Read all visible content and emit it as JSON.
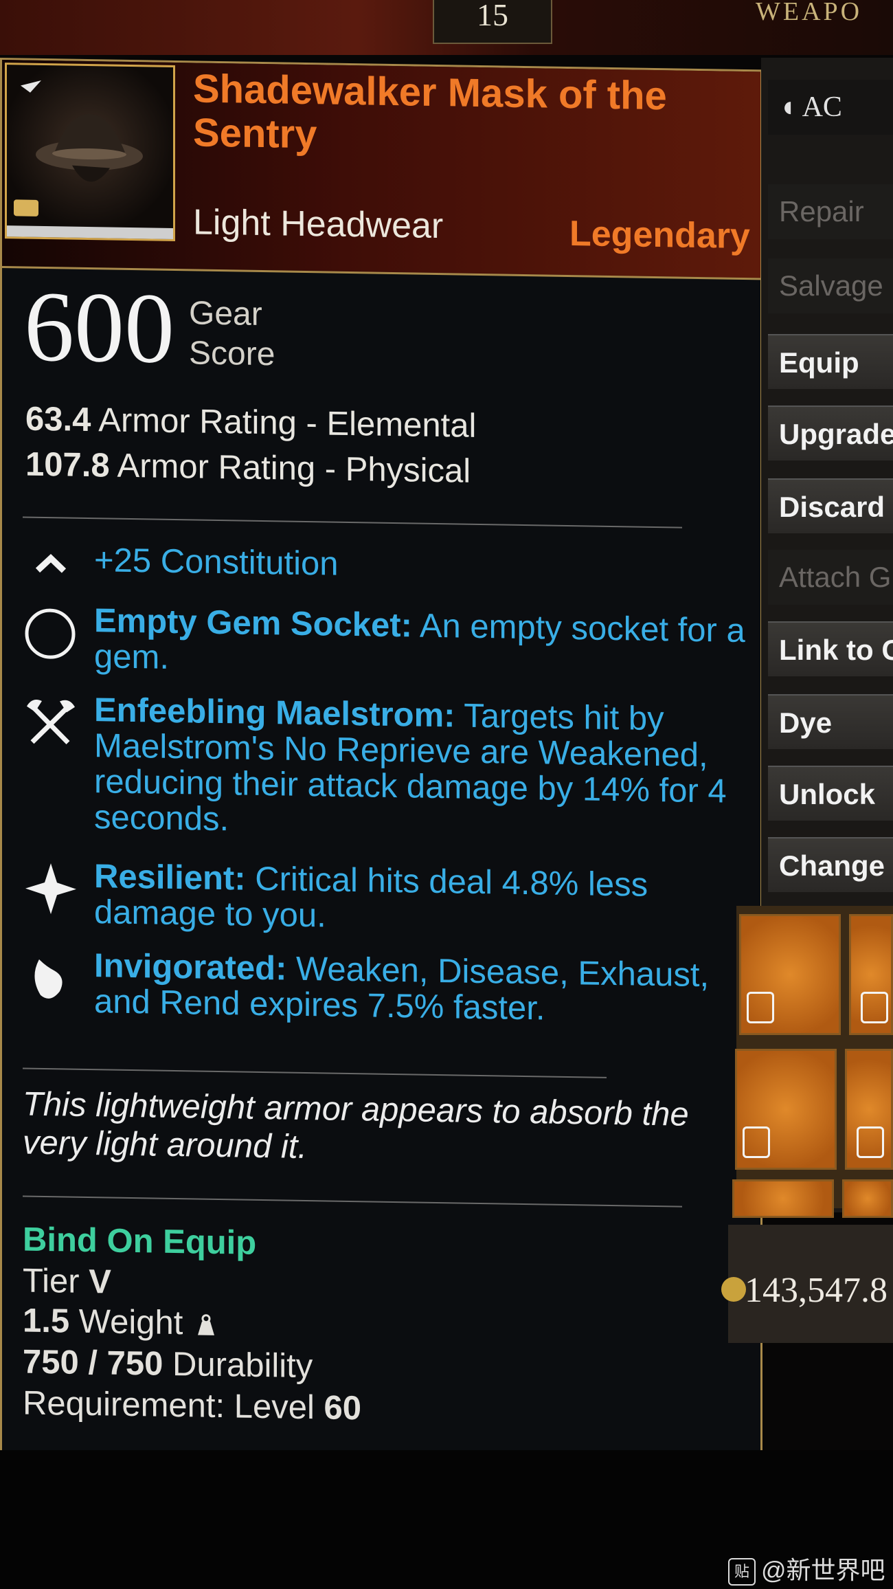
{
  "top": {
    "level_badge": "15",
    "weapon_tab": "WEAPO"
  },
  "item": {
    "title": "Shadewalker Mask of the Sentry",
    "type": "Light Headwear",
    "rarity": "Legendary",
    "gear_score_value": "600",
    "gear_score_label_1": "Gear",
    "gear_score_label_2": "Score",
    "armor": [
      {
        "value": "63.4",
        "label": "Armor Rating - Elemental"
      },
      {
        "value": "107.8",
        "label": "Armor Rating - Physical"
      }
    ],
    "attribute": {
      "value": "+25",
      "label": "Constitution"
    },
    "perks": [
      {
        "name": "Empty Gem Socket:",
        "desc": "An empty socket for a gem.",
        "icon": "gem-socket-icon"
      },
      {
        "name": "Enfeebling Maelstrom:",
        "desc": "Targets hit by Maelstrom's No Reprieve are Weakened, reducing their attack damage by 14% for 4 seconds.",
        "icon": "crossed-hatchets-icon"
      },
      {
        "name": "Resilient:",
        "desc": "Critical hits deal 4.8% less damage to you.",
        "icon": "star-burst-icon"
      },
      {
        "name": "Invigorated:",
        "desc": "Weaken, Disease, Exhaust, and Rend expires 7.5% faster.",
        "icon": "leaf-hand-icon"
      }
    ],
    "flavor": "This lightweight armor appears to absorb the very light around it.",
    "bind": "Bind On Equip",
    "tier_label": "Tier",
    "tier_value": "V",
    "weight_value": "1.5",
    "weight_label": "Weight",
    "durability_value": "750 / 750",
    "durability_label": "Durability",
    "requirement_label": "Requirement: Level",
    "requirement_value": "60"
  },
  "menu": {
    "actions_header": "AC",
    "items": [
      {
        "label": "Repair",
        "enabled": false
      },
      {
        "label": "Salvage",
        "enabled": false
      },
      {
        "label": "Equip",
        "enabled": true
      },
      {
        "label": "Upgrade",
        "enabled": true
      },
      {
        "label": "Discard",
        "enabled": true
      },
      {
        "label": "Attach G",
        "enabled": false
      },
      {
        "label": "Link to C",
        "enabled": true
      },
      {
        "label": "Dye",
        "enabled": true
      },
      {
        "label": "Unlock",
        "enabled": true
      },
      {
        "label": "Change S",
        "enabled": true
      }
    ]
  },
  "currency": {
    "value": "143,547.8"
  },
  "watermark": {
    "text": "@新世界吧",
    "logo": "贴"
  },
  "colors": {
    "legendary": "#f07a28",
    "perk_blue": "#39aee6",
    "bind_green": "#3ecf9e",
    "frame_gold": "#a8894a"
  }
}
